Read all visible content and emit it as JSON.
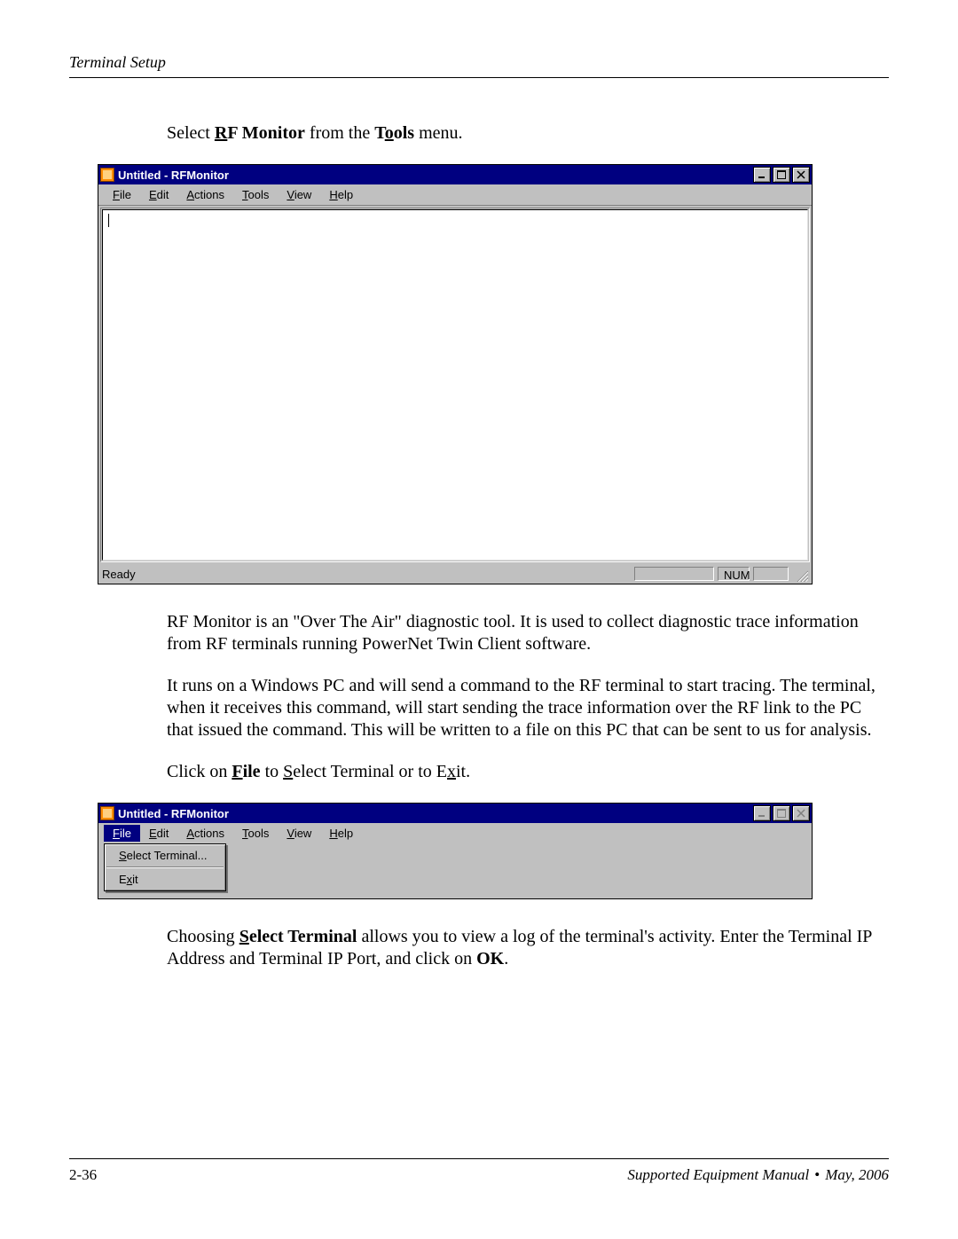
{
  "header": {
    "section": "Terminal Setup"
  },
  "intro": {
    "p1_pre": "Select ",
    "p1_rf_u": "R",
    "p1_rf_rest": "F Monitor",
    "p1_mid": " from the ",
    "p1_tools_pre": "T",
    "p1_tools_u": "o",
    "p1_tools_post": "ols",
    "p1_end": " menu."
  },
  "win1": {
    "title": "Untitled - RFMonitor",
    "menus": {
      "file": {
        "u": "F",
        "rest": "ile"
      },
      "edit": {
        "u": "E",
        "rest": "dit"
      },
      "actions": {
        "u": "A",
        "rest": "ctions"
      },
      "tools": {
        "u": "T",
        "rest": "ools"
      },
      "view": {
        "u": "V",
        "rest": "iew"
      },
      "help": {
        "u": "H",
        "rest": "elp"
      }
    },
    "status": {
      "ready": "Ready",
      "num": "NUM"
    }
  },
  "body": {
    "p2": "RF Monitor is an \"Over The Air\" diagnostic tool. It is used to collect diagnostic trace information from RF terminals running PowerNet Twin Client software.",
    "p3": "It runs on a Windows PC and will send a command to the RF terminal to start tracing. The terminal, when it receives this command, will start sending the trace information over the RF link to the PC that issued the command. This will be written to a file on this PC that can be sent to us for analysis.",
    "p4_pre": "Click on ",
    "p4_file_u": "F",
    "p4_file_rest": "ile",
    "p4_mid": " to ",
    "p4_sel_u": "S",
    "p4_sel_rest": "elect Terminal or to E",
    "p4_exit_u": "x",
    "p4_exit_rest": "it."
  },
  "win2": {
    "title": "Untitled - RFMonitor",
    "menus": {
      "file": {
        "u": "F",
        "rest": "ile"
      },
      "edit": {
        "u": "E",
        "rest": "dit"
      },
      "actions": {
        "u": "A",
        "rest": "ctions"
      },
      "tools": {
        "u": "T",
        "rest": "ools"
      },
      "view": {
        "u": "V",
        "rest": "iew"
      },
      "help": {
        "u": "H",
        "rest": "elp"
      }
    },
    "dropdown": {
      "select_pre": "",
      "select_u": "S",
      "select_rest": "elect Terminal...",
      "exit_pre": "E",
      "exit_u": "x",
      "exit_rest": "it"
    }
  },
  "after": {
    "p5_pre": "Choosing ",
    "p5_sel_u": "S",
    "p5_sel_rest": "elect Terminal",
    "p5_mid": " allows you to view a log of the terminal's activity. Enter the Terminal IP Address and Terminal IP Port, and click on ",
    "p5_ok": "OK",
    "p5_end": "."
  },
  "footer": {
    "page": "2-36",
    "manual": "Supported Equipment Manual",
    "date": "May, 2006"
  }
}
